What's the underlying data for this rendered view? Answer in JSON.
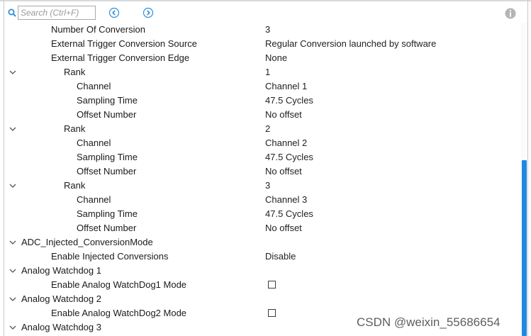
{
  "search": {
    "placeholder": "Search (Ctrl+F)"
  },
  "icons": {
    "search": "search-icon",
    "back": "circle-chevron-left-icon",
    "forward": "circle-chevron-right-icon",
    "info": "info-icon",
    "expand": "chevron-down-icon"
  },
  "colors": {
    "accent": "#1e88e5",
    "icon_blue": "#2f8fd8",
    "text": "#1a1a1a",
    "muted": "#9a9a9a"
  },
  "rows": [
    {
      "label": "Number Of Conversion",
      "value": "3",
      "level": 2
    },
    {
      "label": "External Trigger Conversion Source",
      "value": "Regular Conversion launched by software",
      "level": 2
    },
    {
      "label": "External Trigger Conversion Edge",
      "value": "None",
      "level": 2
    },
    {
      "label": "Rank",
      "value": "1",
      "level": 3,
      "expandable": true
    },
    {
      "label": "Channel",
      "value": "Channel 1",
      "level": 4
    },
    {
      "label": "Sampling Time",
      "value": "47.5 Cycles",
      "level": 4
    },
    {
      "label": "Offset Number",
      "value": "No offset",
      "level": 4
    },
    {
      "label": "Rank",
      "value": "2",
      "level": 3,
      "expandable": true
    },
    {
      "label": "Channel",
      "value": "Channel 2",
      "level": 4
    },
    {
      "label": "Sampling Time",
      "value": "47.5 Cycles",
      "level": 4
    },
    {
      "label": "Offset Number",
      "value": "No offset",
      "level": 4
    },
    {
      "label": "Rank",
      "value": "3",
      "level": 3,
      "expandable": true
    },
    {
      "label": "Channel",
      "value": "Channel 3",
      "level": 4
    },
    {
      "label": "Sampling Time",
      "value": "47.5 Cycles",
      "level": 4
    },
    {
      "label": "Offset Number",
      "value": "No offset",
      "level": 4
    },
    {
      "label": "ADC_Injected_ConversionMode",
      "value": "",
      "level": 1,
      "expandable": true
    },
    {
      "label": "Enable Injected Conversions",
      "value": "Disable",
      "level": 2
    },
    {
      "label": "Analog Watchdog 1",
      "value": "",
      "level": 1,
      "expandable": true
    },
    {
      "label": "Enable Analog WatchDog1 Mode",
      "value": "",
      "level": 2,
      "checkbox": true,
      "checked": false
    },
    {
      "label": "Analog Watchdog 2",
      "value": "",
      "level": 1,
      "expandable": true
    },
    {
      "label": "Enable Analog WatchDog2 Mode",
      "value": "",
      "level": 2,
      "checkbox": true,
      "checked": false
    },
    {
      "label": "Analog Watchdog 3",
      "value": "",
      "level": 1,
      "expandable": true
    }
  ],
  "watermark": "CSDN @weixin_55686654"
}
